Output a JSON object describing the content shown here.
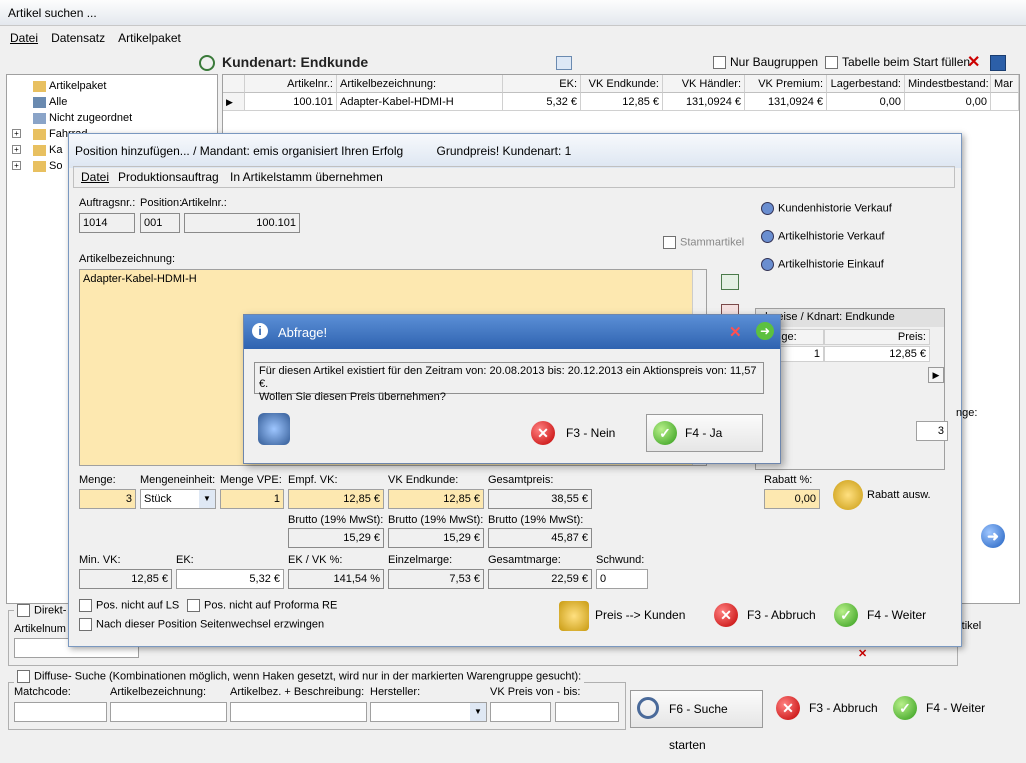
{
  "window": {
    "title": "Artikel suchen ..."
  },
  "menu": {
    "datei": "Datei",
    "datensatz": "Datensatz",
    "artikelpaket": "Artikelpaket"
  },
  "header": {
    "kundenart": "Kundenart: Endkunde",
    "nur_baugruppen": "Nur Baugruppen",
    "tabelle_fuellen": "Tabelle beim Start füllen"
  },
  "tree": {
    "items": [
      "Artikelpaket",
      "Alle",
      "Nicht zugeordnet",
      "Fahrrad",
      "Ka",
      "So"
    ]
  },
  "grid": {
    "columns": [
      "Artikelnr.:",
      "Artikelbezeichnung:",
      "EK:",
      "VK Endkunde:",
      "VK Händler:",
      "VK Premium:",
      "Lagerbestand:",
      "Mindestbestand:",
      "Mar"
    ],
    "rows": [
      [
        "100.101",
        "Adapter-Kabel-HDMI-H",
        "5,32 €",
        "12,85 €",
        "131,0924 €",
        "131,0924 €",
        "0,00",
        "0,00",
        ""
      ]
    ]
  },
  "dialog": {
    "title": "Position hinzufügen... / Mandant: emis organisiert Ihren Erfolg",
    "grundpreis": "Grundpreis! Kundenart: 1",
    "menu": {
      "datei": "Datei",
      "produktionsauftrag": "Produktionsauftrag",
      "uebernehmen": "In Artikelstamm übernehmen"
    },
    "labels": {
      "auftragsnr": "Auftragsnr.:",
      "position": "Position:",
      "artikelnr": "Artikelnr.:",
      "stammartikel": "Stammartikel",
      "artikelbezeichnung": "Artikelbezeichnung:",
      "menge": "Menge:",
      "mengeneinheit": "Mengeneinheit:",
      "menge_vpe": "Menge VPE:",
      "empf_vk": "Empf. VK:",
      "vk_endkunde": "VK Endkunde:",
      "gesamtpreis": "Gesamtpreis:",
      "brutto1": "Brutto (19% MwSt):",
      "brutto2": "Brutto (19% MwSt):",
      "brutto3": "Brutto (19% MwSt):",
      "min_vk": "Min. VK:",
      "ek": "EK:",
      "ek_vk": "EK / VK %:",
      "einzelmarge": "Einzelmarge:",
      "gesamtmarge": "Gesamtmarge:",
      "schwund": "Schwund:",
      "rabatt": "Rabatt %:",
      "pos_nicht_ls": "Pos. nicht auf LS",
      "pos_nicht_proforma": "Pos. nicht auf Proforma RE",
      "seitenwechsel": "Nach dieser Position Seitenwechsel erzwingen"
    },
    "values": {
      "auftragsnr": "1014",
      "position": "001",
      "artikelnr": "100.101",
      "artikelbezeichnung": "Adapter-Kabel-HDMI-H",
      "menge": "3",
      "mengeneinheit": "Stück",
      "menge_vpe": "1",
      "empf_vk": "12,85 €",
      "vk_endkunde": "12,85 €",
      "gesamtpreis": "38,55 €",
      "brutto_empf": "15,29 €",
      "brutto_vk": "15,29 €",
      "brutto_gesamt": "45,87 €",
      "min_vk": "12,85 €",
      "ek": "5,32 €",
      "ek_vk": "141,54 %",
      "einzelmarge": "7,53 €",
      "gesamtmarge": "22,59 €",
      "schwund": "0",
      "rabatt": "0,00"
    },
    "side": {
      "kundenhistorie": "Kundenhistorie Verkauf",
      "artikelhistorie_vk": "Artikelhistorie Verkauf",
      "artikelhistorie_ek": "Artikelhistorie Einkauf",
      "staffel_title": "elpreise / Kdnart: Endkunde",
      "staffel_menge": "Menge:",
      "staffel_preis": "Preis:",
      "staffel_row_menge": "1",
      "staffel_row_preis": "12,85 €",
      "menge_label": "nge:",
      "menge_val": "3"
    },
    "buttons": {
      "rabatt_ausw": "Rabatt ausw.",
      "preis_kunden": "Preis --> Kunden",
      "abbruch": "F3 - Abbruch",
      "weiter": "F4 - Weiter"
    }
  },
  "messagebox": {
    "title": "Abfrage!",
    "text_line1": "Für diesen Artikel existiert für den Zeitram von: 20.08.2013 bis: 20.12.2013 ein Aktionspreis von: 11,57 €.",
    "text_line2": "Wollen Sie diesen Preis übernehmen?",
    "btn_nein": "F3 - Nein",
    "btn_ja": "F4 - Ja"
  },
  "bottom": {
    "direkt": "Direkt-",
    "artikelnum": "Artikelnum",
    "rtikel": "rtikel",
    "diffuse": "Diffuse- Suche (Kombinationen möglich, wenn Haken gesetzt, wird nur in der markierten Warengruppe gesucht):",
    "matchcode": "Matchcode:",
    "artikelbezeichnung": "Artikelbezeichnung:",
    "artikelbez_beschr": "Artikelbez. + Beschreibung:",
    "hersteller": "Hersteller:",
    "vk_preis": "VK Preis von - bis:",
    "suche_starten": "F6 - Suche starten",
    "abbruch": "F3 - Abbruch",
    "weiter": "F4 - Weiter"
  }
}
